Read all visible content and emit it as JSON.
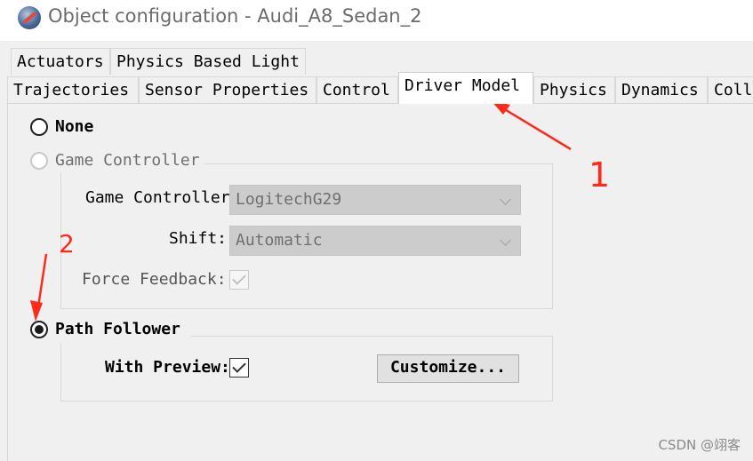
{
  "window": {
    "title": "Object configuration - Audi_A8_Sedan_2",
    "icon": "car-app-icon"
  },
  "tabs": {
    "row1": [
      "Actuators",
      "Physics Based Light"
    ],
    "row2": [
      "Trajectories",
      "Sensor Properties",
      "Control",
      "Driver Model",
      "Physics",
      "Dynamics",
      "Coll"
    ],
    "active": "Driver Model"
  },
  "driver_model": {
    "none_label": "None",
    "game_controller_label": "Game Controller",
    "game_controller_field_label": "Game Controller",
    "game_controller_value": "LogitechG29",
    "shift_label": "Shift:",
    "shift_value": "Automatic",
    "force_feedback_label": "Force Feedback:",
    "force_feedback_checked": true,
    "path_follower_label": "Path Follower",
    "with_preview_label": "With Preview:",
    "with_preview_checked": true,
    "customize_button": "Customize...",
    "selected": "Path Follower"
  },
  "annotations": {
    "marker_1": "1",
    "marker_2": "2",
    "color": "#ff2a1a"
  },
  "watermark": "CSDN @翊客"
}
